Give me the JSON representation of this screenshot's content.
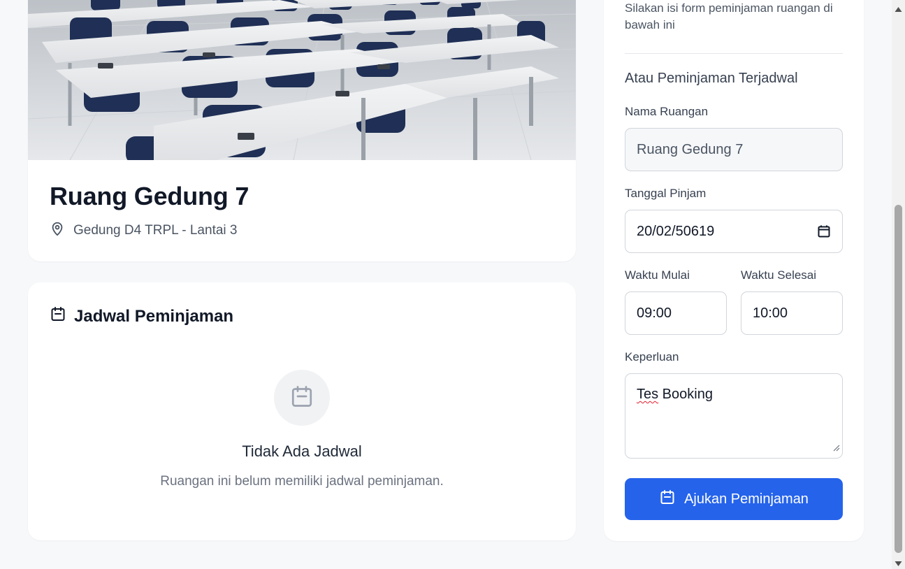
{
  "room": {
    "name": "Ruang Gedung 7",
    "location": "Gedung D4 TRPL - Lantai 3",
    "location_icon": "map-pin-icon",
    "photo_alt": "classroom-photo"
  },
  "schedule": {
    "title": "Jadwal Peminjaman",
    "title_icon": "calendar-icon",
    "empty_icon": "calendar-icon",
    "empty_title": "Tidak Ada Jadwal",
    "empty_desc": "Ruangan ini belum memiliki jadwal peminjaman."
  },
  "form": {
    "intro": "Silakan isi form peminjaman ruangan di bawah ini",
    "section_title": "Atau Peminjaman Terjadwal",
    "room_label": "Nama Ruangan",
    "room_value": "Ruang Gedung 7",
    "date_label": "Tanggal Pinjam",
    "date_value": "20/02/50619",
    "start_label": "Waktu Mulai",
    "start_value": "09:00",
    "end_label": "Waktu Selesai",
    "end_value": "10:00",
    "purpose_label": "Keperluan",
    "purpose_value_word1": "Tes",
    "purpose_value_rest": " Booking",
    "submit_label": "Ajukan Peminjaman",
    "submit_icon": "calendar-icon"
  },
  "colors": {
    "primary": "#2563eb",
    "background": "#f7f8fa",
    "card": "#ffffff",
    "text_muted": "#6b7280"
  }
}
